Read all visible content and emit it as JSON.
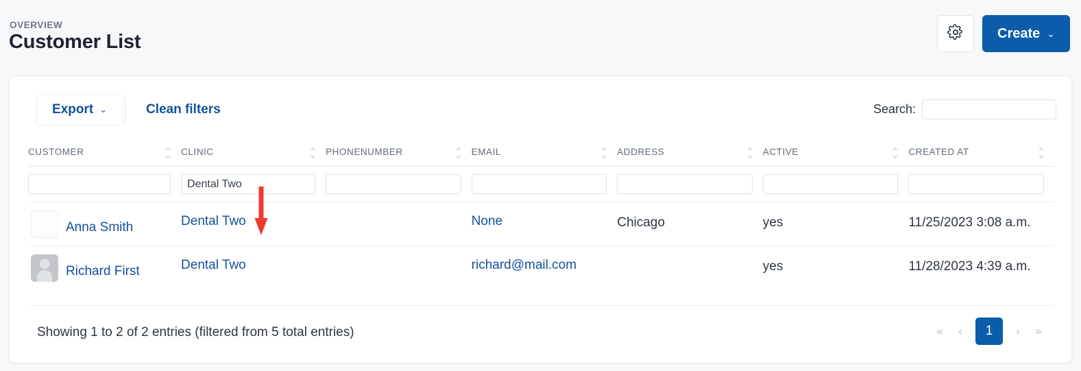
{
  "header": {
    "overview_label": "OVERVIEW",
    "title": "Customer List",
    "gear_icon": "gear-icon",
    "create_label": "Create",
    "create_caret": "⌄"
  },
  "toolbar": {
    "export_label": "Export",
    "export_caret": "⌄",
    "clean_filters_label": "Clean filters",
    "search_label": "Search:",
    "search_value": "",
    "search_placeholder": ""
  },
  "table": {
    "columns": [
      {
        "label": "CUSTOMER",
        "filter_value": "",
        "sortable": true
      },
      {
        "label": "CLINIC",
        "filter_value": "Dental Two",
        "sortable": true
      },
      {
        "label": "PHONENUMBER",
        "filter_value": "",
        "sortable": true
      },
      {
        "label": "EMAIL",
        "filter_value": "",
        "sortable": true
      },
      {
        "label": "ADDRESS",
        "filter_value": "",
        "sortable": true
      },
      {
        "label": "ACTIVE",
        "filter_value": "",
        "sortable": true
      },
      {
        "label": "CREATED AT",
        "filter_value": "",
        "sortable": true
      }
    ],
    "rows": [
      {
        "avatar": "blank-image-placeholder",
        "customer": "Anna Smith",
        "clinic": "Dental Two",
        "phonenumber": "",
        "email": "None",
        "address": "Chicago",
        "active": "yes",
        "created_at": "11/25/2023 3:08 a.m."
      },
      {
        "avatar": "default-person-avatar",
        "customer": "Richard First",
        "clinic": "Dental Two",
        "phonenumber": "",
        "email": "richard@mail.com",
        "address": "",
        "active": "yes",
        "created_at": "11/28/2023 4:39 a.m."
      }
    ]
  },
  "footer": {
    "showing_text": "Showing 1 to 2 of 2 entries (filtered from 5 total entries)",
    "pagination": {
      "first_label": "«",
      "prev_label": "‹",
      "current_page": "1",
      "next_label": "›",
      "last_label": "»"
    }
  },
  "annotation": {
    "arrow_color": "#ef3b2d",
    "arrow_direction": "down"
  },
  "colors": {
    "accent_blue": "#0b5cab",
    "link_blue": "#11519c",
    "page_bg": "#f6f8fa",
    "card_bg": "#ffffff"
  }
}
